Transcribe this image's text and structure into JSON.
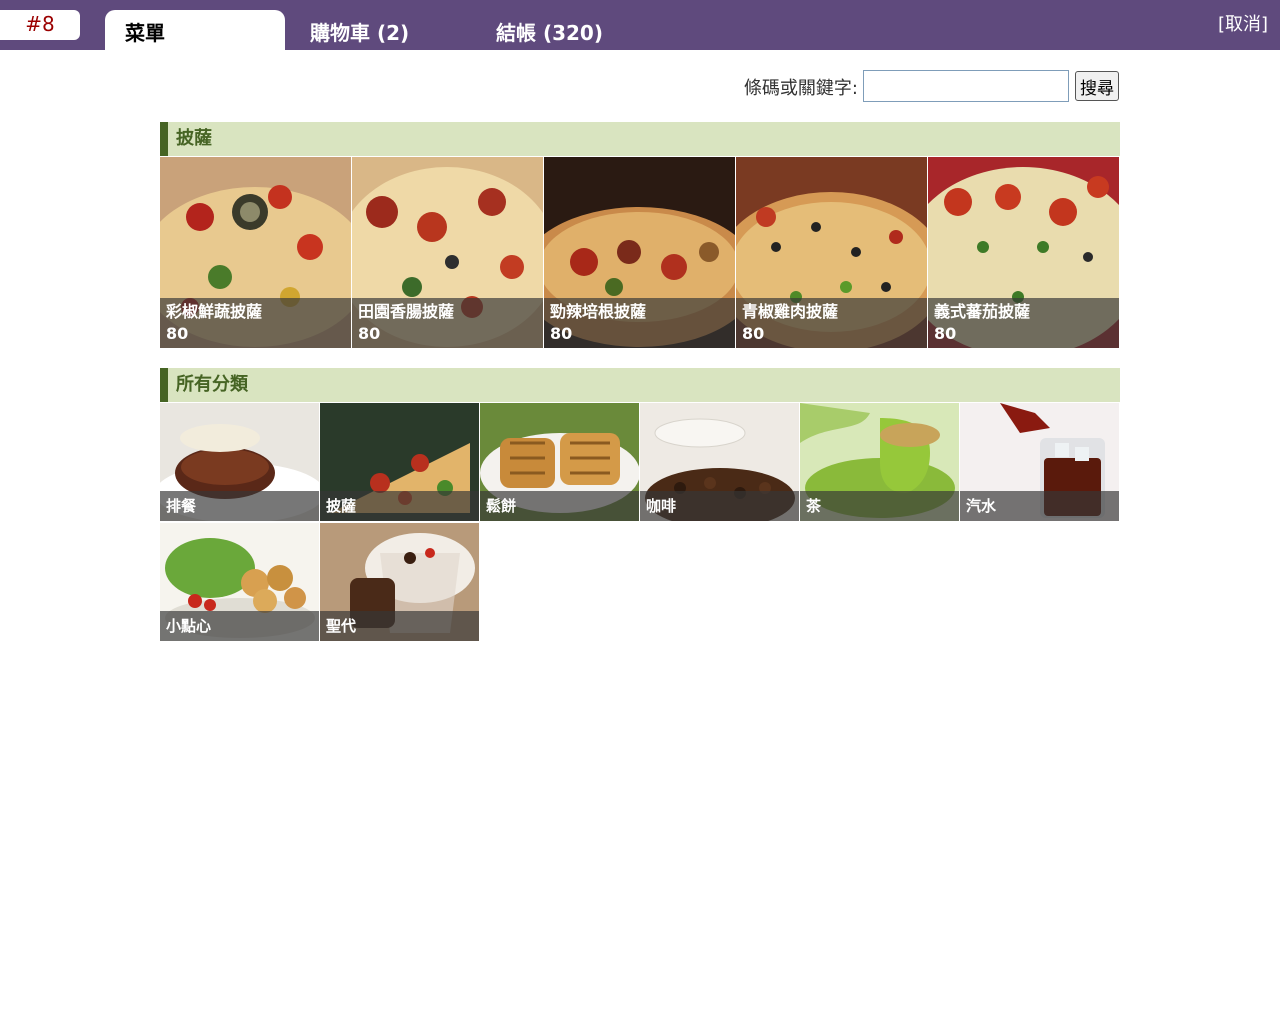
{
  "header": {
    "order_number": "#8",
    "tabs": [
      {
        "label": "菜單"
      },
      {
        "label": "購物車 (2)"
      },
      {
        "label": "結帳 (320)"
      }
    ],
    "cancel_label": "[取消]"
  },
  "search": {
    "label": "條碼或關鍵字:",
    "value": "",
    "button_label": "搜尋"
  },
  "featured": {
    "title": "披薩",
    "products": [
      {
        "name": "彩椒鮮蔬披薩",
        "price": "80"
      },
      {
        "name": "田園香腸披薩",
        "price": "80"
      },
      {
        "name": "勁辣培根披薩",
        "price": "80"
      },
      {
        "name": "青椒雞肉披薩",
        "price": "80"
      },
      {
        "name": "義式蕃茄披薩",
        "price": "80"
      }
    ]
  },
  "categories": {
    "title": "所有分類",
    "items": [
      {
        "label": "排餐"
      },
      {
        "label": "披薩"
      },
      {
        "label": "鬆餅"
      },
      {
        "label": "咖啡"
      },
      {
        "label": "茶"
      },
      {
        "label": "汽水"
      },
      {
        "label": "小點心"
      },
      {
        "label": "聖代"
      }
    ]
  },
  "colors": {
    "topbar": "#5f4a7d",
    "order_number": "#9b0000",
    "section_header_bg": "#d9e4c0",
    "section_header_accent": "#466424"
  }
}
